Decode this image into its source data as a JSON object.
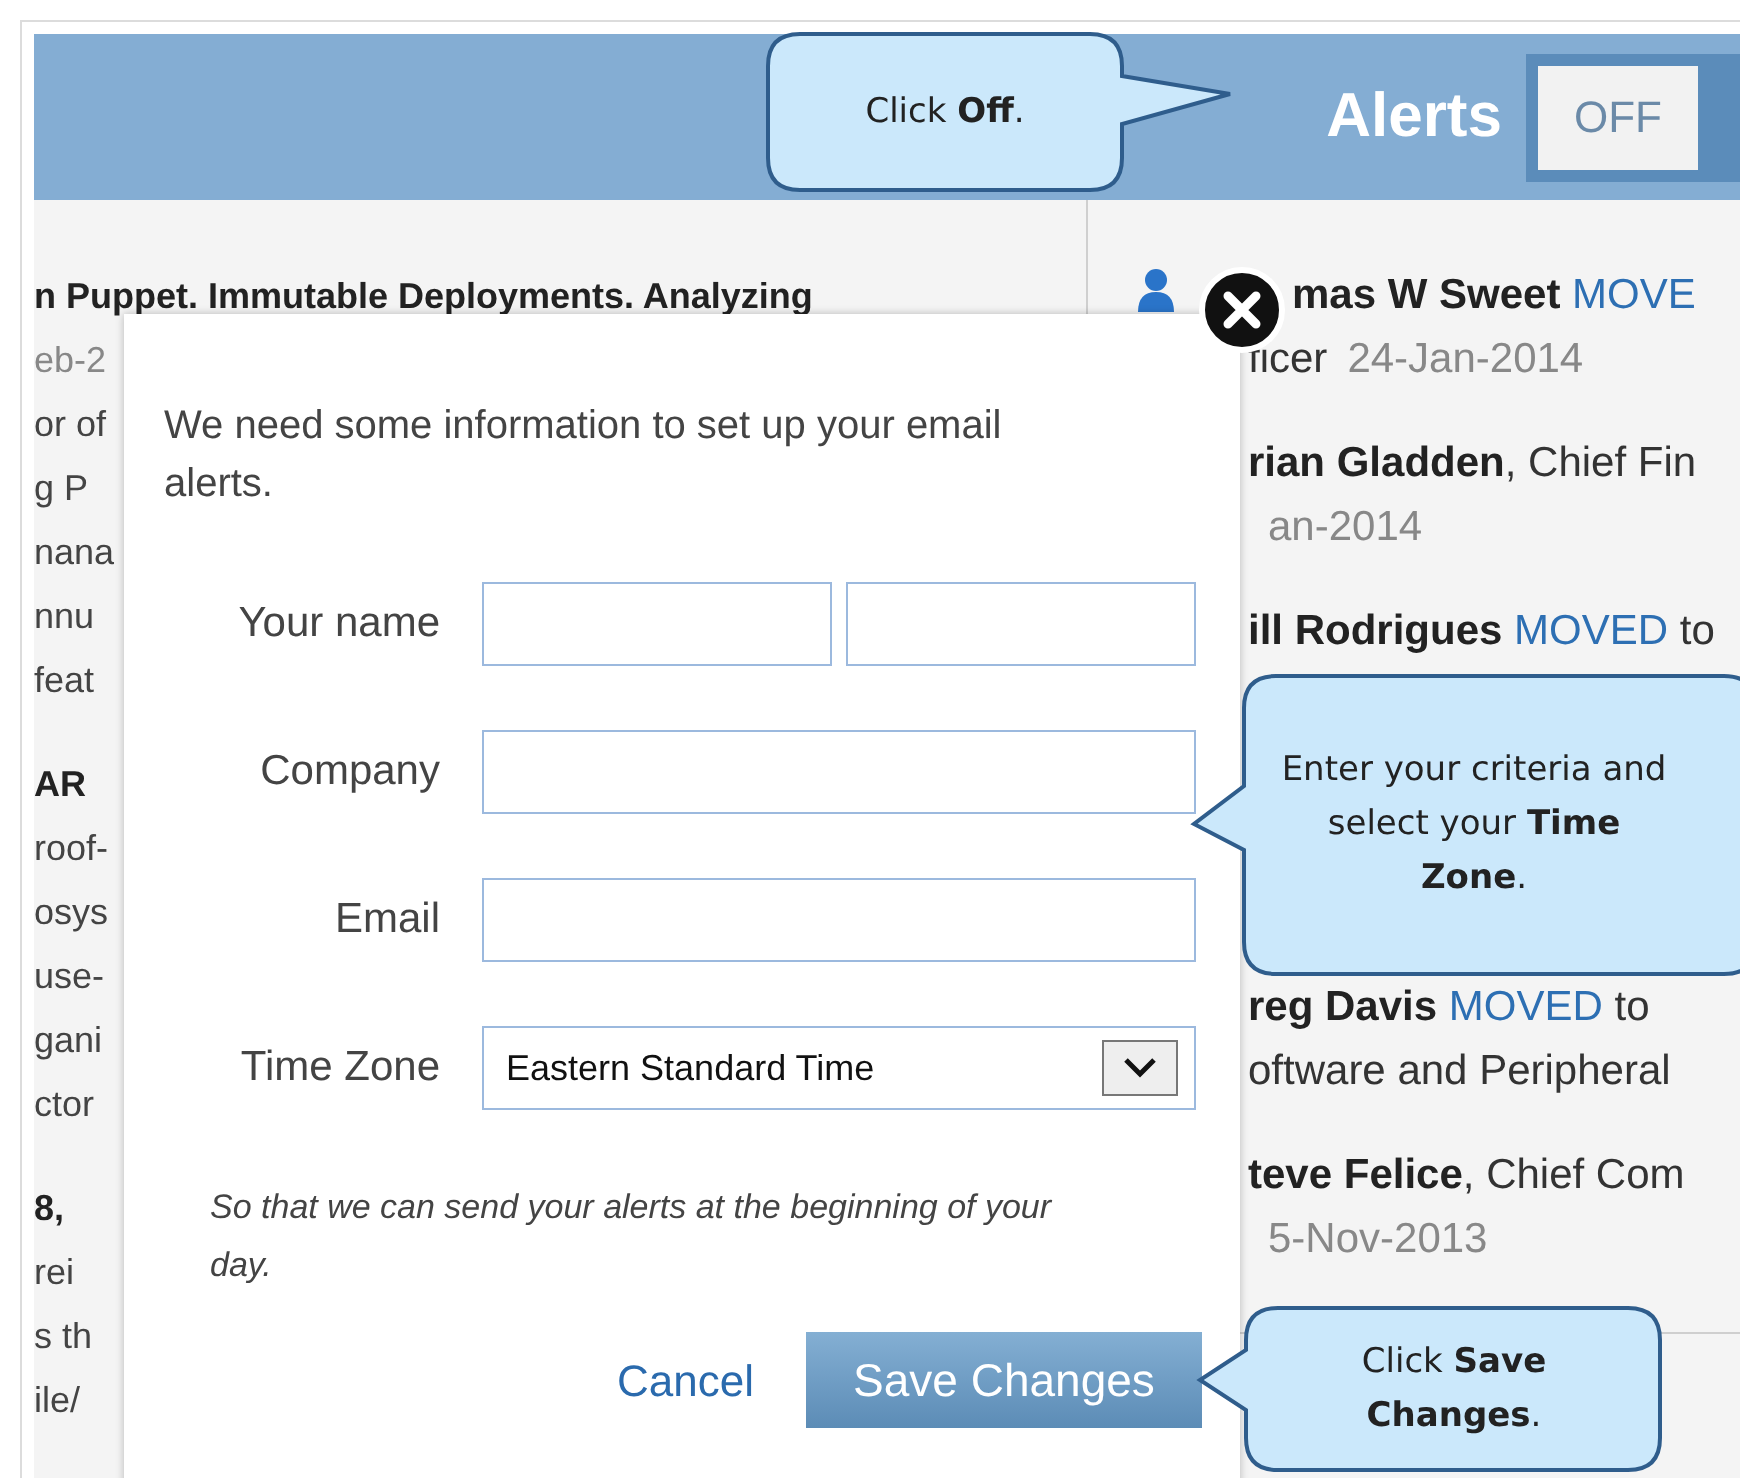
{
  "header": {
    "title": "Alerts",
    "toggle": {
      "label": "OFF"
    }
  },
  "left_column": {
    "lines": [
      {
        "text": "n Puppet. Immutable Deployments. Analyzing",
        "kind": "title"
      },
      {
        "text": "eb-2",
        "kind": "date"
      },
      {
        "text": "or of",
        "kind": "body"
      },
      {
        "text": "g P",
        "kind": "body"
      },
      {
        "text": "nana",
        "kind": "body"
      },
      {
        "text": "nnu",
        "kind": "body"
      },
      {
        "text": "feat",
        "kind": "body"
      },
      {
        "text": "AR",
        "kind": "title"
      },
      {
        "text": "roof-",
        "kind": "body"
      },
      {
        "text": "osys",
        "kind": "body"
      },
      {
        "text": "use-",
        "kind": "body"
      },
      {
        "text": "gani",
        "kind": "body"
      },
      {
        "text": "ctor",
        "kind": "body"
      },
      {
        "text": "8,",
        "kind": "title"
      },
      {
        "text": "rei",
        "kind": "body"
      },
      {
        "text": "s th",
        "kind": "body"
      },
      {
        "text": "ile/",
        "kind": "body"
      }
    ]
  },
  "right_column": {
    "sections": [
      {
        "items": [
          {
            "lines": [
              [
                {
                  "text": "mas W Sweet",
                  "kind": "name"
                },
                {
                  "text": " MOVE",
                  "kind": "moved"
                }
              ],
              [
                {
                  "text": "ficer",
                  "kind": "plain"
                },
                {
                  "text": "24-Jan-2014",
                  "kind": "date"
                }
              ]
            ]
          },
          {
            "lines": [
              [
                {
                  "text": "rian Gladden",
                  "kind": "name"
                },
                {
                  "text": ", Chief Fin",
                  "kind": "plain"
                }
              ],
              [
                {
                  "text": "an-2014",
                  "kind": "date"
                }
              ]
            ]
          },
          {
            "lines": [
              [
                {
                  "text": "ill Rodrigues",
                  "kind": "name"
                },
                {
                  "text": " MOVED",
                  "kind": "moved"
                },
                {
                  "text": " to",
                  "kind": "plain"
                }
              ]
            ]
          }
        ]
      },
      {
        "items": [
          {
            "lines": [
              [
                {
                  "text": "reg Davis",
                  "kind": "name"
                },
                {
                  "text": " MOVED",
                  "kind": "moved"
                },
                {
                  "text": " to",
                  "kind": "plain"
                }
              ],
              [
                {
                  "text": "oftware and Peripheral",
                  "kind": "plain"
                }
              ]
            ]
          },
          {
            "lines": [
              [
                {
                  "text": "teve Felice",
                  "kind": "name"
                },
                {
                  "text": ", Chief Com",
                  "kind": "plain"
                }
              ],
              [
                {
                  "text": "5-Nov-2013",
                  "kind": "date"
                }
              ]
            ]
          }
        ]
      }
    ]
  },
  "dialog": {
    "intro": "We need some information to set up your email alerts.",
    "fields": [
      {
        "label": "Your name",
        "kind": "name_pair"
      },
      {
        "label": "Company",
        "kind": "text"
      },
      {
        "label": "Email",
        "kind": "text"
      },
      {
        "label": "Time Zone",
        "kind": "select",
        "value": "Eastern Standard Time"
      }
    ],
    "note": "So that we can send your alerts at the beginning of your day.",
    "cancel": "Cancel",
    "save": "Save Changes"
  },
  "callouts": [
    {
      "text": "Click **Off**."
    },
    {
      "text": "Enter your criteria and select your **Time Zone**."
    },
    {
      "text": "Click **Save Changes**."
    }
  ]
}
